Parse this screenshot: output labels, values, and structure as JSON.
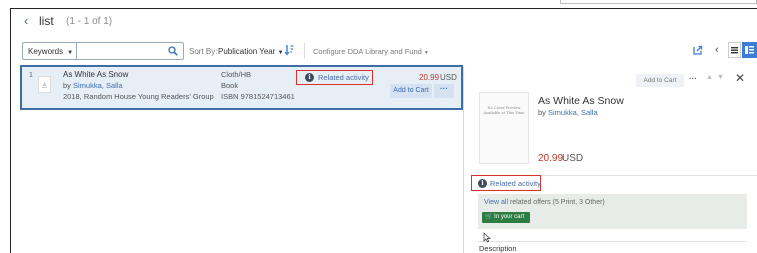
{
  "header": {
    "back_glyph": "‹",
    "title": "list",
    "count": "(1 - 1 of 1)"
  },
  "toolbar": {
    "keyword_select": "Keywords",
    "search_placeholder": "",
    "sort_by_label": "Sort By:",
    "sort_by_value": "Publication Year",
    "configure_label": "Configure DDA Library and Fund",
    "icons": [
      "search-icon",
      "sort-order-icon",
      "export-icon",
      "chevron-left-icon",
      "list-view-icon",
      "split-view-icon"
    ]
  },
  "results": [
    {
      "index": "1",
      "title": "As White As Snow",
      "author_prefix": "by",
      "author": "Simukka, Salla",
      "publication": "2018, Random House Young Readers' Group",
      "binding": "Cloth/HB",
      "type": "Book",
      "isbn": "ISBN 9781524713461",
      "related_label": "Related activity",
      "price": "20.99",
      "currency": "USD",
      "add_to_cart": "Add to Cart",
      "more": "···"
    }
  ],
  "detail_panel": {
    "add_to_cart": "Add to Cart",
    "more": "···",
    "close": "✕",
    "up": "▲",
    "down": "▼",
    "cover_text": "No Cover Preview Available at This Time",
    "title": "As White As Snow",
    "author_prefix": "by",
    "author": "Simukka, Salla",
    "price": "20.99",
    "currency": "USD",
    "related_label": "Related activity",
    "view_all_link": "View all",
    "view_all_rest": "related offers (5 Print, 3 Other)",
    "in_cart_badge": "In your cart",
    "description_label": "Description"
  },
  "colors": {
    "accent_blue": "#3c7dd9",
    "highlight_red": "#d9302b",
    "price_red": "#c0392b",
    "in_cart_green": "#2d7d42",
    "selected_row_bg": "#e6eef6"
  }
}
